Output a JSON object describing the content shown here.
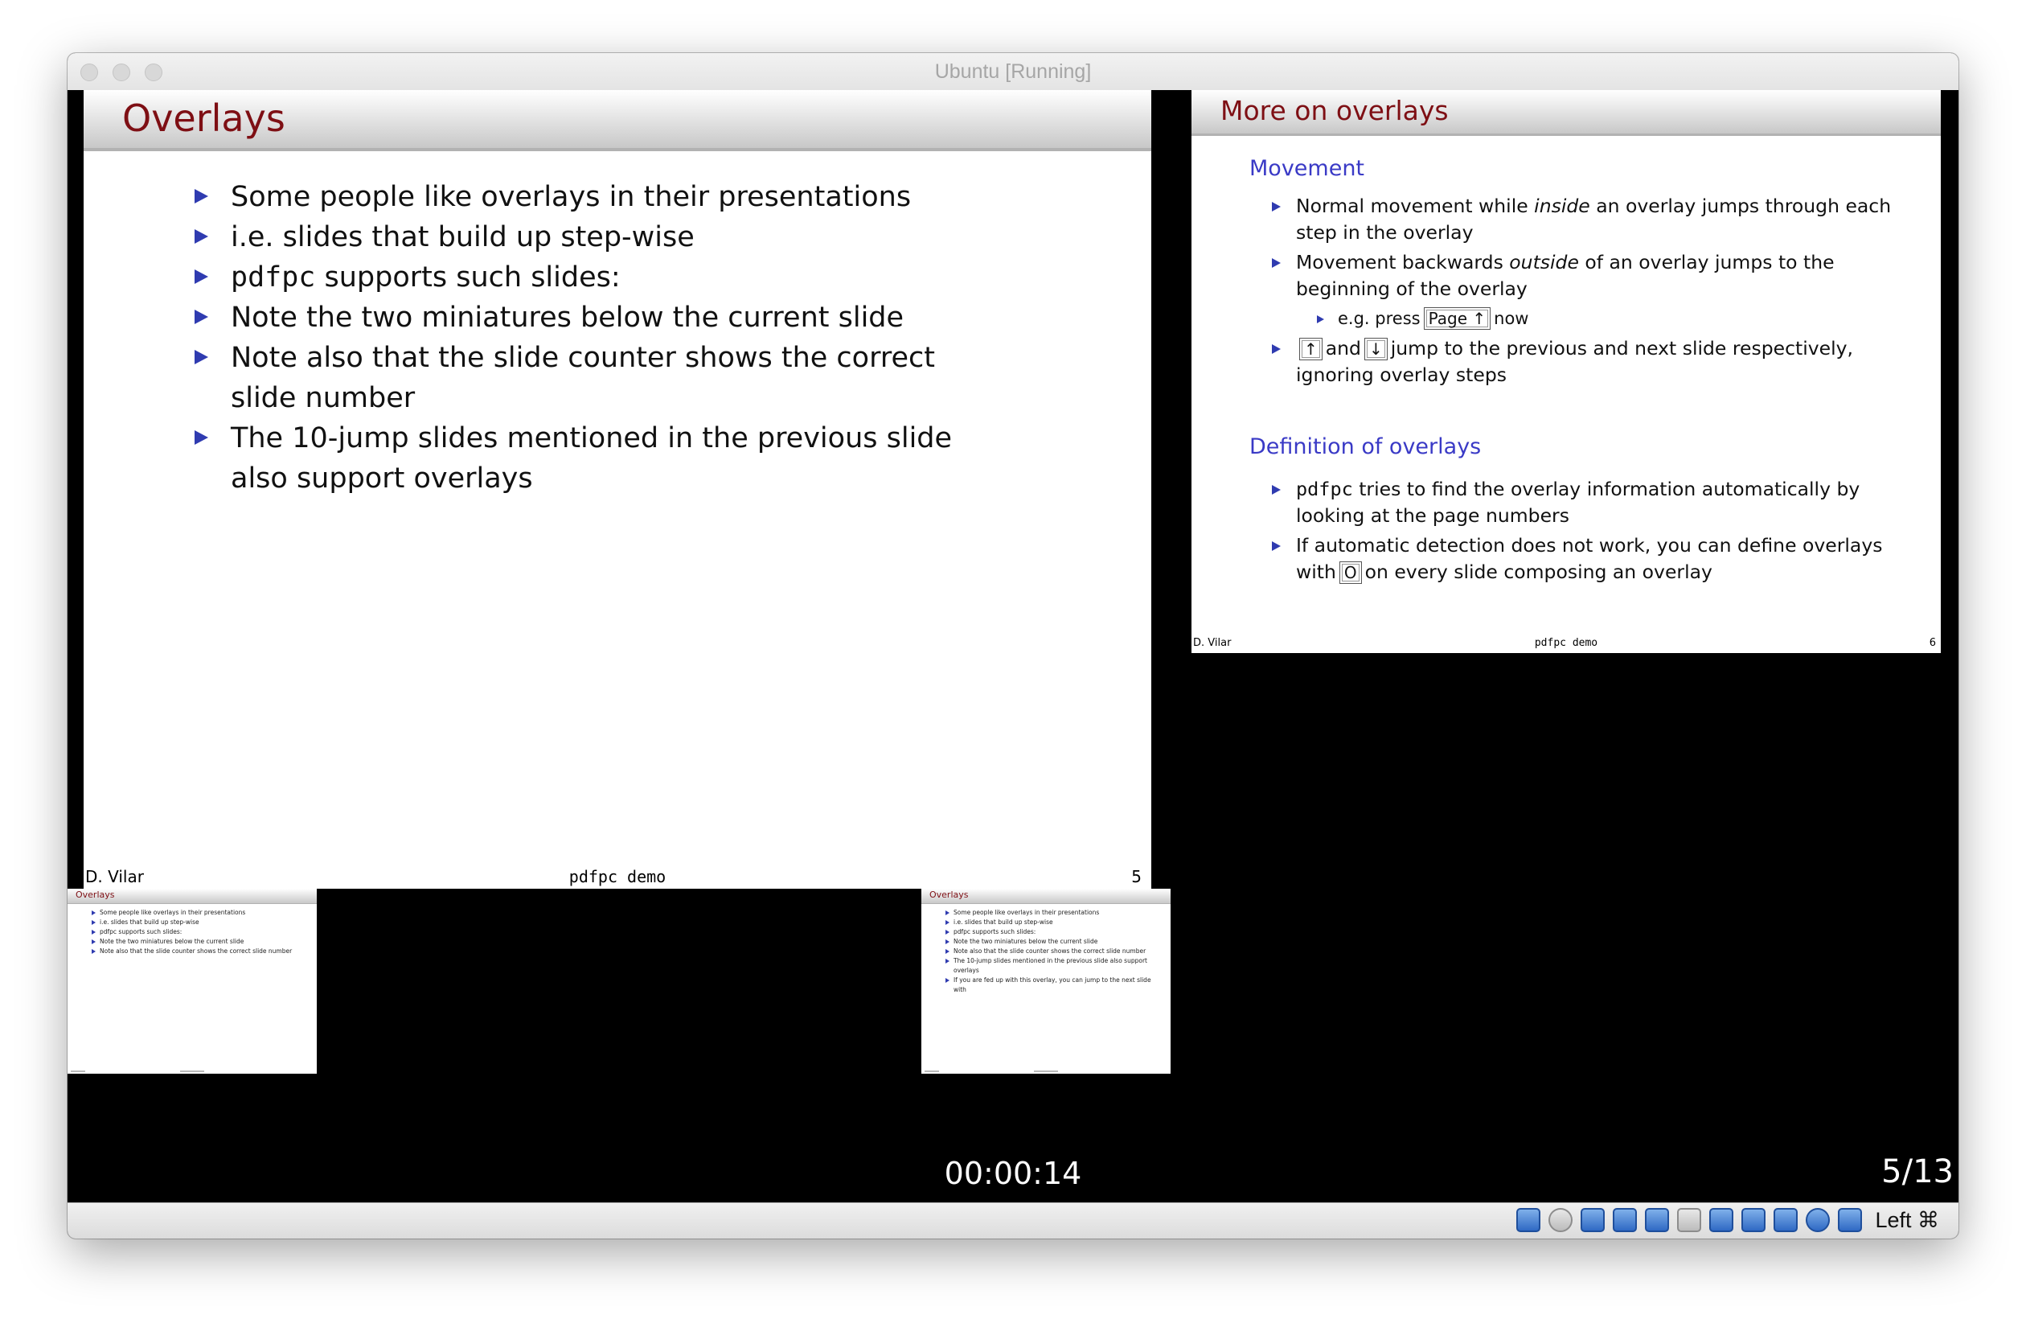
{
  "window": {
    "title": "Ubuntu [Running]",
    "host_key": "Left ⌘"
  },
  "current_slide": {
    "title": "Overlays",
    "bullets": {
      "b0": "Some people like overlays in their presentations",
      "b1": "i.e. slides that build up step-wise",
      "b2_code": "pdfpc",
      "b2_rest": " supports such slides:",
      "b3": "Note the two miniatures below the current slide",
      "b4": "Note also that the slide counter shows the correct slide number",
      "b5": "The 10-jump slides mentioned in the previous slide also support overlays"
    },
    "footer": {
      "author": "D. Vilar",
      "title": "pdfpc demo",
      "page": "5"
    }
  },
  "next_slide": {
    "title": "More on overlays",
    "movement": {
      "heading": "Movement",
      "i0_a": "Normal movement while ",
      "i0_em": "inside",
      "i0_b": " an overlay jumps through each step in the overlay",
      "i1_a": "Movement backwards ",
      "i1_em": "outside",
      "i1_b": " of an overlay jumps to the beginning of the overlay",
      "sub_a": "e.g. press",
      "sub_key": "Page ↑",
      "sub_b": "now",
      "i2_key1": "↑",
      "i2_and": "and",
      "i2_key2": "↓",
      "i2_rest": "jump to the previous and next slide respectively, ignoring overlay steps"
    },
    "definition": {
      "heading": "Definition of overlays",
      "i0_code": "pdfpc",
      "i0_rest": " tries to find the overlay information automatically by looking at the page numbers",
      "i1_a": "If automatic detection does not work, you can define overlays with",
      "i1_key": "O",
      "i1_b": "on every slide composing an overlay"
    },
    "footer": {
      "author": "D. Vilar",
      "title": "pdfpc demo",
      "page": "6"
    }
  },
  "overlay_prev": {
    "title": "Overlays",
    "items": [
      "Some people like overlays in their presentations",
      "i.e. slides that build up step-wise",
      "pdfpc supports such slides:",
      "Note the two miniatures below the current slide",
      "Note also that the slide counter shows the correct slide number"
    ]
  },
  "overlay_next": {
    "title": "Overlays",
    "items": [
      "Some people like overlays in their presentations",
      "i.e. slides that build up step-wise",
      "pdfpc supports such slides:",
      "Note the two miniatures below the current slide",
      "Note also that the slide counter shows the correct slide number",
      "The 10-jump slides mentioned in the previous slide also support overlays",
      "If you are fed up with this overlay, you can jump to the next slide with"
    ]
  },
  "presenter": {
    "timer": "00:00:14",
    "counter": "5/13"
  },
  "status_icons": [
    "hard-disk-icon",
    "optical-drive-icon",
    "audio-icon",
    "network-icon",
    "usb-icon",
    "shared-folder-icon",
    "display-icon",
    "video-capture-icon",
    "cpu-icon",
    "mouse-integration-icon",
    "keyboard-capture-icon"
  ],
  "colors": {
    "frame_title": "#7e0f14",
    "bullet": "#2f3bb0",
    "block_heading": "#3a3ac6"
  }
}
